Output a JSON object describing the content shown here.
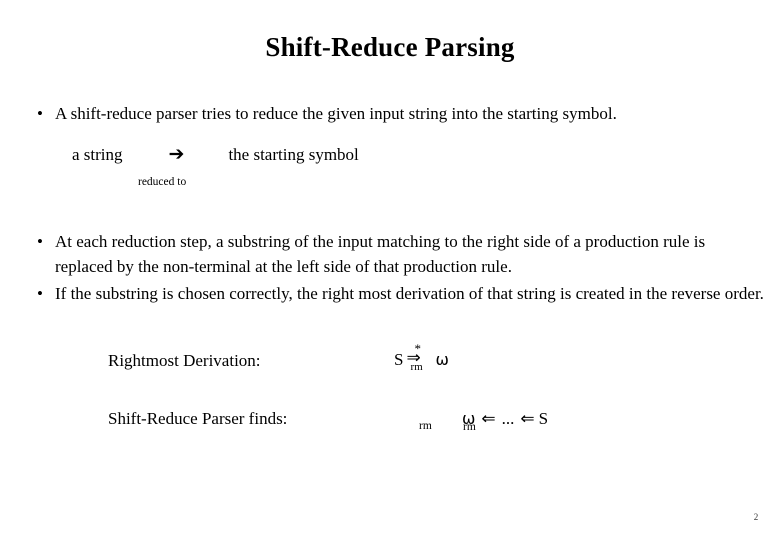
{
  "slide": {
    "title": "Shift-Reduce Parsing",
    "page_number": "2",
    "background_color": "#ffffff",
    "text_color": "#000000"
  },
  "bullets": [
    {
      "marker": "•",
      "text": "A shift-reduce parser tries to reduce the given input string into the starting symbol."
    },
    {
      "marker": "•",
      "text": "At each reduction step, a substring of the input matching to the right side of a production rule is replaced by the non-terminal at the left side of that production rule."
    },
    {
      "marker": "•",
      "text": "If the substring is chosen correctly, the right most derivation of that string is created in the reverse order."
    }
  ],
  "reduction_diagram": {
    "left_term": "a string",
    "arrow_glyph": "➔",
    "right_term": "the starting symbol",
    "caption": "reduced to"
  },
  "derivations": [
    {
      "label": "Rightmost Derivation:",
      "start_symbol": "S",
      "star": "*",
      "arrow_glyph": "⇒",
      "subscript": "rm",
      "end_symbol": "ω"
    },
    {
      "label": "Shift-Reduce Parser finds:",
      "subscript_left": "rm",
      "subscript_right": "rm",
      "start_symbol": "ω",
      "arrow_glyph": "⇐",
      "ellipsis": "...",
      "end_symbol": "S"
    }
  ]
}
